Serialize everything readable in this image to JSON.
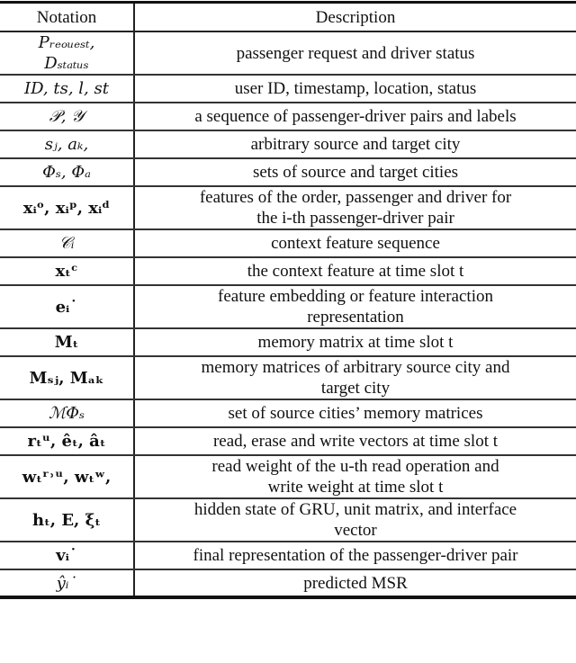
{
  "table": {
    "headers": [
      "Notation",
      "Description"
    ],
    "rows": [
      {
        "notation": "P_request,\nD_status",
        "notation_display": "Pᵣₑₒᵤₑₛₜ,\nDₛₜₐₜᵤₛ",
        "description": "passenger request and driver status",
        "height": 47
      },
      {
        "notation": "ID, ts, l, st",
        "notation_display": "ID, ts, l, st",
        "description": "user ID, timestamp, location, status"
      },
      {
        "notation": "𝒫, 𝒴",
        "notation_display": "𝒫, 𝒴",
        "description": "a sequence of passenger-driver pairs and labels"
      },
      {
        "notation": "s_j, a_k,",
        "notation_display": "sⱼ, aₖ,",
        "description": "arbitrary source and target city"
      },
      {
        "notation": "Φ_s, Φ_a",
        "notation_display": "Φₛ, Φₐ",
        "description": "sets of source and target cities"
      },
      {
        "notation": "x_i^o, x_i^p, x_i^d",
        "notation_display": "xᵢᵒ, xᵢᵖ, xᵢᵈ",
        "description": "features of the order, passenger and driver for\nthe i-th passenger-driver pair"
      },
      {
        "notation": "𝒞_i",
        "notation_display": "𝒞ᵢ",
        "description": "context feature sequence"
      },
      {
        "notation": "x_t^c",
        "notation_display": "xₜᶜ",
        "description": "the context feature at time slot t"
      },
      {
        "notation": "e_i^·",
        "notation_display": "eᵢ˙",
        "description": "feature embedding or feature interaction\nrepresentation"
      },
      {
        "notation": "M_t",
        "notation_display": "Mₜ",
        "description": "memory matrix at time slot t"
      },
      {
        "notation": "M_{s_j}, M_{a_k}",
        "notation_display": "Mₛⱼ, Mₐₖ",
        "description": "memory matrices of arbitrary source city and\ntarget city"
      },
      {
        "notation": "ℳ_{Φ_s}",
        "notation_display": "ℳΦₛ",
        "description": "set of source cities’ memory matrices"
      },
      {
        "notation": "r_t^u, ê_t, â_t",
        "notation_display": "rₜᵘ, êₜ, âₜ",
        "description": "read, erase and write vectors at time slot t"
      },
      {
        "notation": "w_t^{r,u}, w_t^w,",
        "notation_display": "wₜʳ˒ᵘ, wₜʷ,",
        "description": "read weight of the u-th read operation and\nwrite weight at time slot t"
      },
      {
        "notation": "h_t, E, ξ_t",
        "notation_display": "hₜ, E, ξₜ",
        "description": "hidden state of GRU, unit matrix, and interface\nvector"
      },
      {
        "notation": "v_i^·",
        "notation_display": "vᵢ˙",
        "description": "final representation of the passenger-driver pair"
      },
      {
        "notation": "ŷ_i^·",
        "notation_display": "ŷᵢ˙",
        "description": "predicted MSR"
      }
    ]
  }
}
